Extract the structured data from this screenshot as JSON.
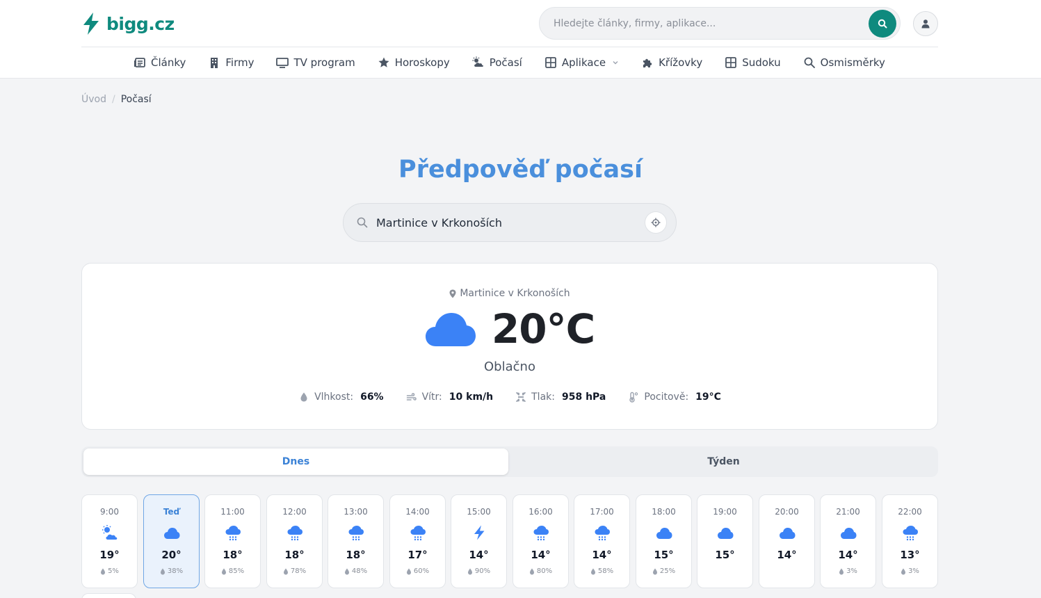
{
  "header": {
    "logo_text": "bigg.cz",
    "search_placeholder": "Hledejte články, firmy, aplikace...",
    "brand_color": "#0f8a7e"
  },
  "nav": [
    {
      "label": "Články",
      "icon": "newspaper-icon"
    },
    {
      "label": "Firmy",
      "icon": "building-icon"
    },
    {
      "label": "TV program",
      "icon": "tv-icon"
    },
    {
      "label": "Horoskopy",
      "icon": "star-icon"
    },
    {
      "label": "Počasí",
      "icon": "cloud-sun-icon"
    },
    {
      "label": "Aplikace",
      "icon": "grid-icon"
    },
    {
      "label": "Křížovky",
      "icon": "puzzle-icon"
    },
    {
      "label": "Sudoku",
      "icon": "grid-icon"
    },
    {
      "label": "Osmisměrky",
      "icon": "search-icon"
    }
  ],
  "breadcrumb": {
    "home": "Úvod",
    "separator": "/",
    "current": "Počasí"
  },
  "page_title": "Předpověď počasí",
  "city_search": {
    "value": "Martinice v Krkonoších"
  },
  "current": {
    "location": "Martinice v Krkonoších",
    "temperature": "20°C",
    "condition": "Oblačno",
    "stats": {
      "humidity_label": "Vlhkost:",
      "humidity_value": "66%",
      "wind_label": "Vítr:",
      "wind_value": "10 km/h",
      "pressure_label": "Tlak:",
      "pressure_value": "958 hPa",
      "feels_label": "Pocitově:",
      "feels_value": "19°C"
    }
  },
  "tabs": {
    "today": "Dnes",
    "week": "Týden",
    "active": "today"
  },
  "accent_color": "#3b82f6",
  "hourly": [
    {
      "time": "9:00",
      "icon": "sun-cloud",
      "temp": "19°",
      "precip": "5%"
    },
    {
      "time": "Teď",
      "icon": "cloud",
      "temp": "20°",
      "precip": "38%",
      "now": true
    },
    {
      "time": "11:00",
      "icon": "cloud-rain",
      "temp": "18°",
      "precip": "85%"
    },
    {
      "time": "12:00",
      "icon": "cloud-rain",
      "temp": "18°",
      "precip": "78%"
    },
    {
      "time": "13:00",
      "icon": "cloud-rain",
      "temp": "18°",
      "precip": "48%"
    },
    {
      "time": "14:00",
      "icon": "cloud-rain",
      "temp": "17°",
      "precip": "60%"
    },
    {
      "time": "15:00",
      "icon": "bolt",
      "temp": "14°",
      "precip": "90%"
    },
    {
      "time": "16:00",
      "icon": "cloud-rain",
      "temp": "14°",
      "precip": "80%"
    },
    {
      "time": "17:00",
      "icon": "cloud-rain",
      "temp": "14°",
      "precip": "58%"
    },
    {
      "time": "18:00",
      "icon": "cloud",
      "temp": "15°",
      "precip": "25%"
    },
    {
      "time": "19:00",
      "icon": "cloud",
      "temp": "15°",
      "precip": ""
    },
    {
      "time": "20:00",
      "icon": "cloud",
      "temp": "14°",
      "precip": ""
    },
    {
      "time": "21:00",
      "icon": "cloud",
      "temp": "14°",
      "precip": "3%"
    },
    {
      "time": "22:00",
      "icon": "cloud-rain",
      "temp": "13°",
      "precip": "3%"
    }
  ]
}
